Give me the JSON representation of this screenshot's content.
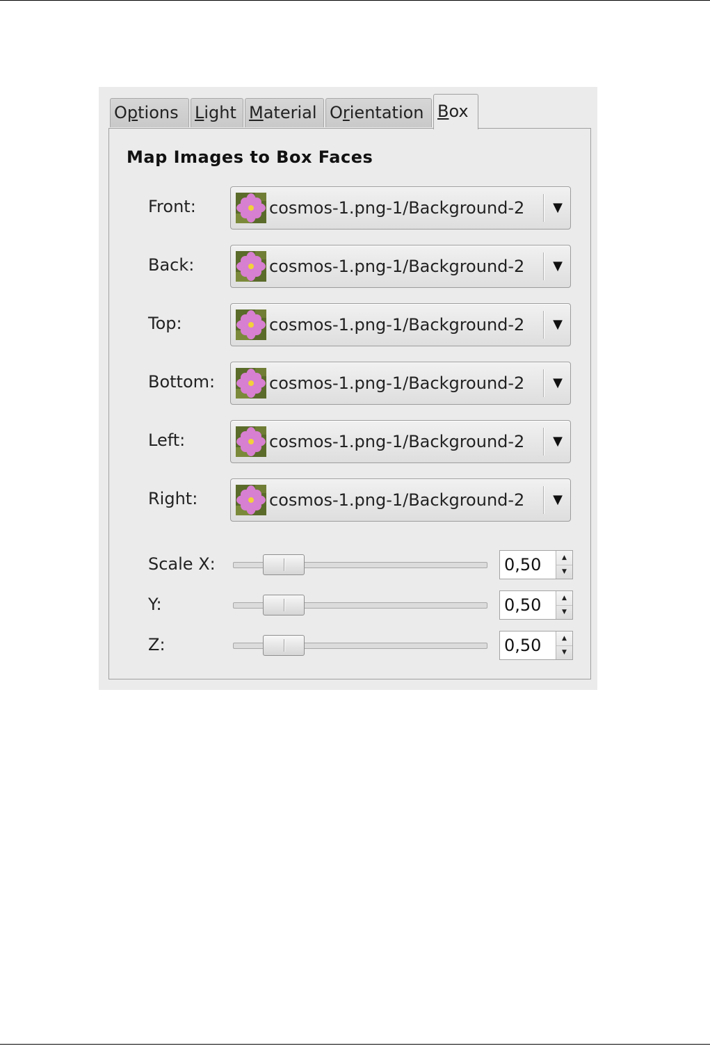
{
  "tabs": [
    {
      "pre": "O",
      "mn": "p",
      "post": "tions"
    },
    {
      "pre": "",
      "mn": "L",
      "post": "ight"
    },
    {
      "pre": "",
      "mn": "M",
      "post": "aterial"
    },
    {
      "pre": "O",
      "mn": "r",
      "post": "ientation"
    },
    {
      "pre": "",
      "mn": "B",
      "post": "ox"
    }
  ],
  "active_tab": "Box",
  "box": {
    "heading": "Map Images to Box Faces",
    "faces": [
      {
        "label": "Front:",
        "value": "cosmos-1.png-1/Background-2"
      },
      {
        "label": "Back:",
        "value": "cosmos-1.png-1/Background-2"
      },
      {
        "label": "Top:",
        "value": "cosmos-1.png-1/Background-2"
      },
      {
        "label": "Bottom:",
        "value": "cosmos-1.png-1/Background-2"
      },
      {
        "label": "Left:",
        "value": "cosmos-1.png-1/Background-2"
      },
      {
        "label": "Right:",
        "value": "cosmos-1.png-1/Background-2"
      }
    ],
    "scale": [
      {
        "label": "Scale X:",
        "value": "0,50",
        "slider_fraction": 0.05
      },
      {
        "label": "Y:",
        "value": "0,50",
        "slider_fraction": 0.05
      },
      {
        "label": "Z:",
        "value": "0,50",
        "slider_fraction": 0.05
      }
    ]
  },
  "icons": {
    "thumbnail": "flower-thumbnail-icon",
    "dropdown": "dropdown-arrow-icon",
    "spin_up": "spin-up-icon",
    "spin_down": "spin-down-icon"
  },
  "colors": {
    "panel_bg": "#ebebeb",
    "flower_petal": "#d77fd0",
    "flower_center": "#f2d23a",
    "foliage": "#5a6b2a"
  }
}
